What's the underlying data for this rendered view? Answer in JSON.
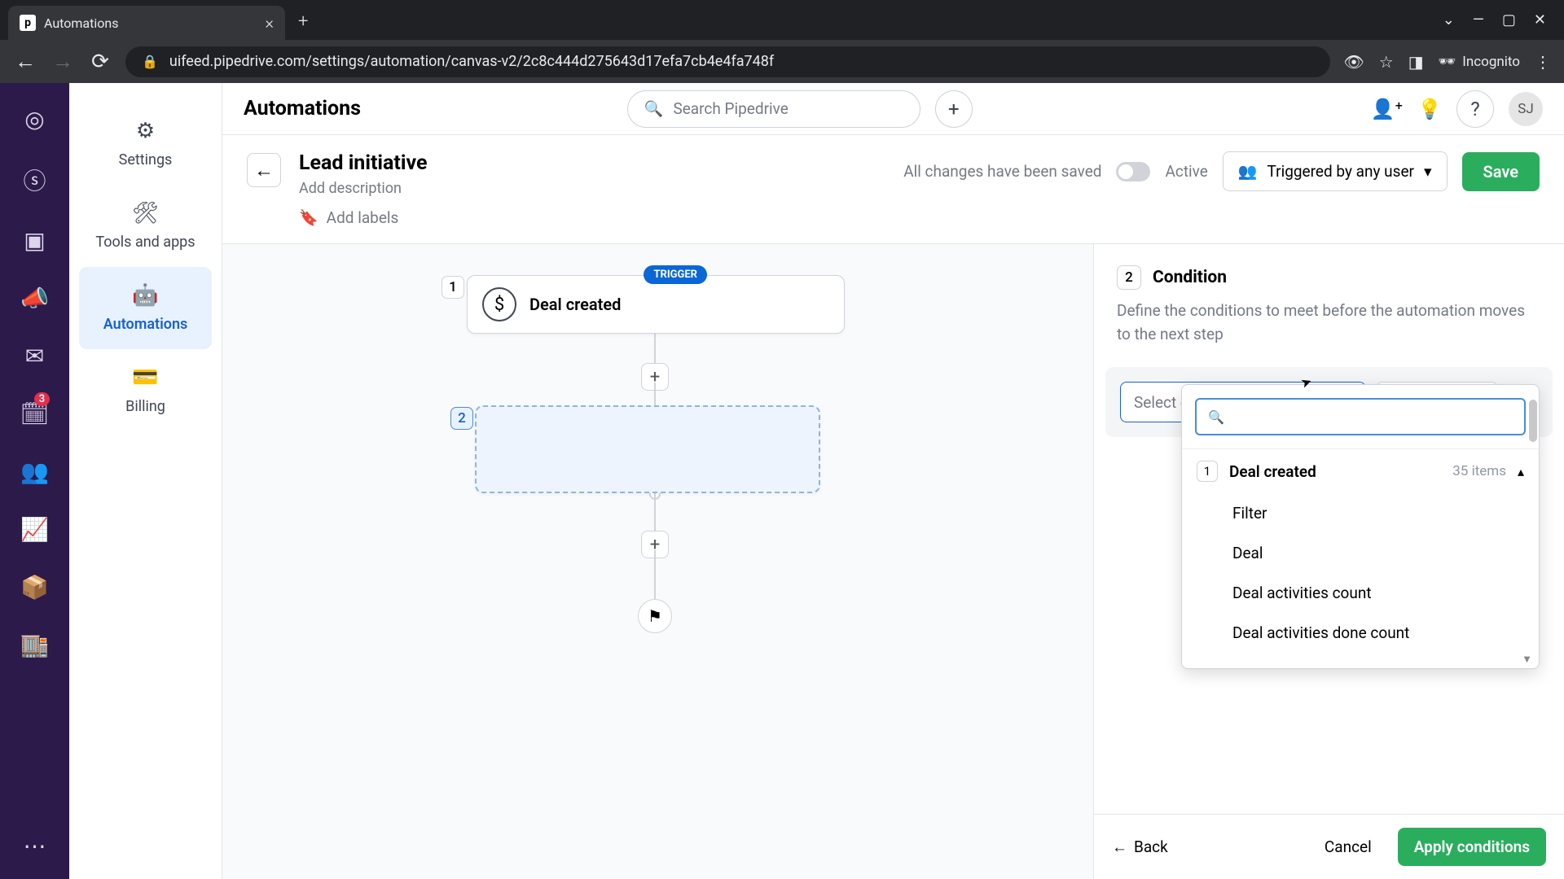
{
  "browser": {
    "tab_title": "Automations",
    "url": "uifeed.pipedrive.com/settings/automation/canvas-v2/2c8c444d275643d17efa7cb4e4fa748f",
    "incognito": "Incognito"
  },
  "topbar": {
    "title": "Automations",
    "search_placeholder": "Search Pipedrive",
    "avatar": "SJ"
  },
  "sidebar": {
    "settings": "Settings",
    "tools": "Tools and apps",
    "automations": "Automations",
    "billing": "Billing"
  },
  "rail": {
    "badge": "3"
  },
  "header": {
    "title": "Lead initiative",
    "desc": "Add description",
    "labels": "Add labels",
    "saved": "All changes have been saved",
    "active": "Active",
    "trigger": "Triggered by any user",
    "save": "Save"
  },
  "canvas": {
    "node1_num": "1",
    "node1_badge": "TRIGGER",
    "node1_label": "Deal created",
    "node2_num": "2"
  },
  "panel": {
    "num": "2",
    "title": "Condition",
    "desc": "Define the conditions to meet before the automation moves to the next step",
    "select_option": "Select option",
    "select": "Select",
    "back": "Back",
    "cancel": "Cancel",
    "apply": "Apply conditions"
  },
  "dropdown": {
    "group_num": "1",
    "group_label": "Deal created",
    "group_count": "35 items",
    "items": [
      "Filter",
      "Deal",
      "Deal activities count",
      "Deal activities done count"
    ]
  }
}
